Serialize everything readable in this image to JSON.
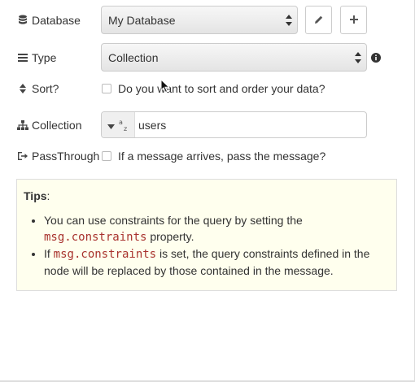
{
  "database": {
    "label": "Database",
    "value": "My Database",
    "edit_button_icon": "pencil-icon",
    "add_button_icon": "plus-icon"
  },
  "type": {
    "label": "Type",
    "value": "Collection",
    "info_icon": "info-circle-icon"
  },
  "sort": {
    "label": "Sort?",
    "checkbox_text": "Do you want to sort and order your data?",
    "checked": false
  },
  "collection": {
    "label": "Collection",
    "type_indicator": "a z",
    "value": "users"
  },
  "passthrough": {
    "label": "PassThrough",
    "checkbox_text": "If a message arrives, pass the message?",
    "checked": false
  },
  "tips": {
    "title": "Tips",
    "title_suffix": ":",
    "item1_a": "You can use constraints for the query by setting the",
    "item1_code": "msg.constraints",
    "item1_b": " property.",
    "item2_a": "If ",
    "item2_code": "msg.constraints",
    "item2_b": " is set, the query constraints defined in the node will be replaced by those contained in the message."
  },
  "colors": {
    "tips_bg": "#ffffee",
    "code": "#a8322d"
  }
}
